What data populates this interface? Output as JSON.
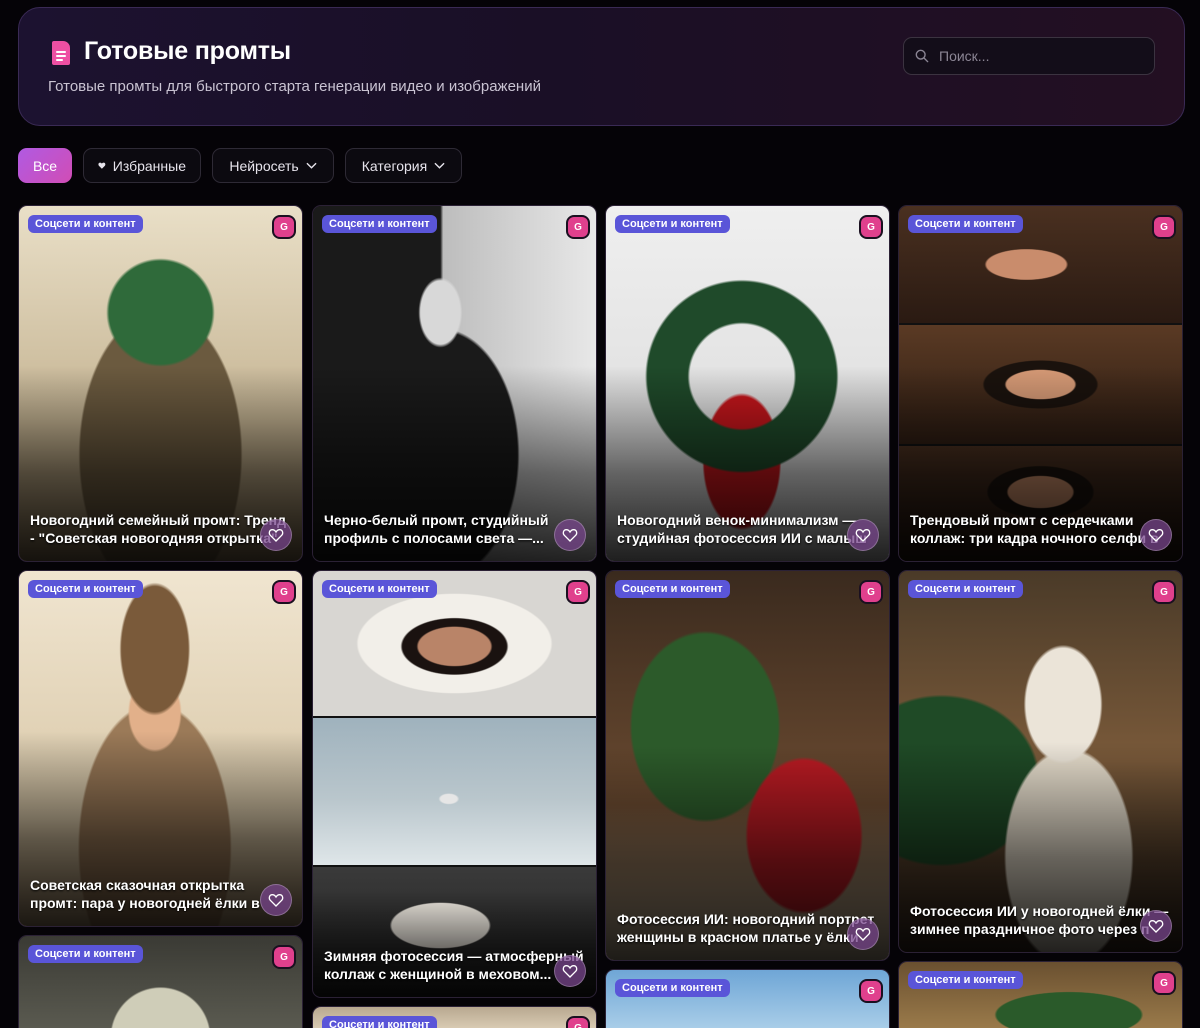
{
  "header": {
    "title": "Готовые промты",
    "subtitle": "Готовые промты для быстрого старта генерации видео и изображений",
    "icon": "document-icon",
    "accent": "#ee4fa3"
  },
  "search": {
    "placeholder": "Поиск..."
  },
  "filters": {
    "all": "Все",
    "favorites": "Избранные",
    "network": "Нейросеть",
    "category": "Категория"
  },
  "cards": [
    {
      "category": "Соцсети и контент",
      "badge": "G",
      "title": "Новогодний семейный промт: Тренд - \"Советская новогодняя открытка\""
    },
    {
      "category": "Соцсети и контент",
      "badge": "G",
      "title": "Черно-белый промт, студийный профиль с полосами света —..."
    },
    {
      "category": "Соцсети и контент",
      "badge": "G",
      "title": "Новогодний венок-минимализм — студийная фотосессия ИИ с малыш"
    },
    {
      "category": "Соцсети и контент",
      "badge": "G",
      "title": "Трендовый промт с сердечками коллаж: три кадра ночного селфи в"
    },
    {
      "category": "Соцсети и контент",
      "badge": "G",
      "title": "Советская сказочная открытка промт: пара у новогодней ёлки в зимнем"
    },
    {
      "category": "Соцсети и контент",
      "badge": "G",
      "title": "Зимняя фотосессия — атмосферный коллаж с женщиной в меховом..."
    },
    {
      "category": "Соцсети и контент",
      "badge": "G",
      "title": "Фотосессия ИИ: новогодний портрет женщины в красном платье у ёлки"
    },
    {
      "category": "Соцсети и контент",
      "badge": "G",
      "title": "Фотосессия ИИ у новогодней ёлки — зимнее праздничное фото через п"
    },
    {
      "category": "Соцсети и контент",
      "badge": "G",
      "title": ""
    },
    {
      "category": "Соцсети и контент",
      "badge": "G",
      "title": ""
    },
    {
      "category": "Соцсети и контент",
      "badge": "G",
      "title": ""
    },
    {
      "category": "Соцсети и контент",
      "badge": "G",
      "title": ""
    }
  ]
}
